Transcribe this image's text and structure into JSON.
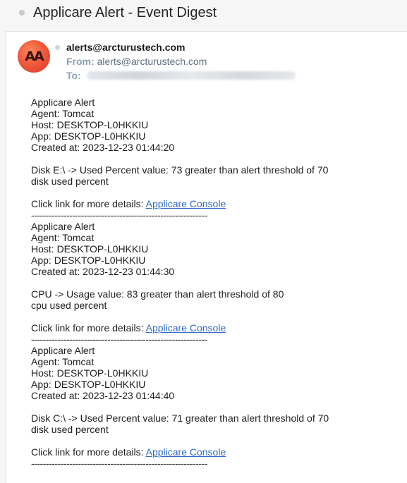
{
  "subject": "Applicare Alert - Event Digest",
  "header": {
    "avatar_initials": "AA",
    "avatar_color": "#f05a3c",
    "sender_email": "alerts@arcturustech.com",
    "from_label": "From:",
    "from_value": "alerts@arcturustech.com",
    "to_label": "To:"
  },
  "alerts": [
    {
      "title": "Applicare Alert",
      "agent": "Agent: Tomcat",
      "host": "Host: DESKTOP-L0HKKIU",
      "app": "App: DESKTOP-L0HKKIU",
      "created": "Created at: 2023-12-23 01:44:20",
      "message_line1": "Disk E:\\ -> Used Percent value: 73 greater than alert threshold of 70",
      "message_line2": "disk used percent",
      "details_text": "Click link for more details: ",
      "link_text": "Applicare Console"
    },
    {
      "title": "Applicare Alert",
      "agent": "Agent: Tomcat",
      "host": "Host: DESKTOP-L0HKKIU",
      "app": "App: DESKTOP-L0HKKIU",
      "created": "Created at: 2023-12-23 01:44:30",
      "message_line1": "CPU -> Usage value: 83 greater than alert threshold of 80",
      "message_line2": "cpu used percent",
      "details_text": "Click link for more details: ",
      "link_text": "Applicare Console"
    },
    {
      "title": "Applicare Alert",
      "agent": "Agent: Tomcat",
      "host": "Host: DESKTOP-L0HKKIU",
      "app": "App: DESKTOP-L0HKKIU",
      "created": "Created at: 2023-12-23 01:44:40",
      "message_line1": "Disk C:\\ -> Used Percent value: 71 greater than alert threshold of 70",
      "message_line2": "disk used percent",
      "details_text": "Click link for more details: ",
      "link_text": "Applicare Console"
    }
  ],
  "separator": "------------------------------------------------------------",
  "link_color": "#2f6bc4"
}
